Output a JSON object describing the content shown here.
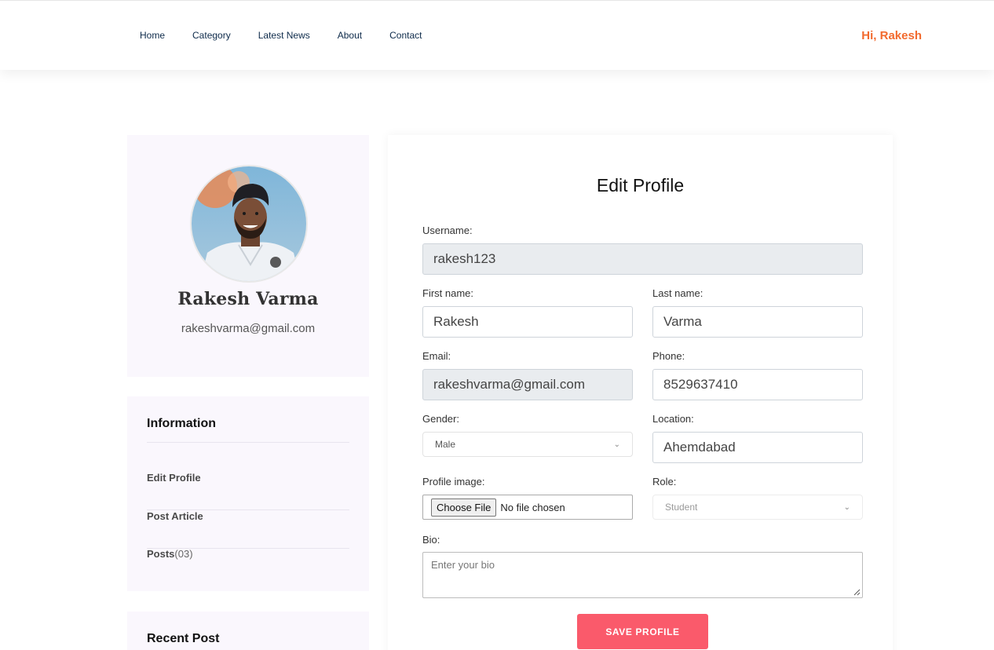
{
  "nav": {
    "items": [
      "Home",
      "Category",
      "Latest News",
      "About",
      "Contact"
    ],
    "greeting": "Hi, Rakesh"
  },
  "profile": {
    "name": "Rakesh Varma",
    "email": "rakeshvarma@gmail.com"
  },
  "info": {
    "title": "Information",
    "items": [
      {
        "label": "Edit Profile",
        "count": ""
      },
      {
        "label": "Post Article",
        "count": ""
      },
      {
        "label": "Posts",
        "count": "(03)"
      }
    ]
  },
  "recent": {
    "title": "Recent Post"
  },
  "form": {
    "title": "Edit Profile",
    "username_label": "Username:",
    "username_value": "rakesh123",
    "first_name_label": "First name:",
    "first_name_value": "Rakesh",
    "last_name_label": "Last name:",
    "last_name_value": "Varma",
    "email_label": "Email:",
    "email_value": "rakeshvarma@gmail.com",
    "phone_label": "Phone:",
    "phone_value": "8529637410",
    "gender_label": "Gender:",
    "gender_value": "Male",
    "location_label": "Location:",
    "location_value": "Ahemdabad",
    "image_label": "Profile image:",
    "choose_file": "Choose File",
    "no_file": "No file chosen",
    "role_label": "Role:",
    "role_value": "Student",
    "bio_label": "Bio:",
    "bio_placeholder": "Enter your bio",
    "save_label": "SAVE PROFILE"
  },
  "colors": {
    "accent": "#f26a2e",
    "save_button": "#fa5a6b",
    "nav_text": "#0d2a4a",
    "sidebar_bg": "#faf7fd"
  }
}
